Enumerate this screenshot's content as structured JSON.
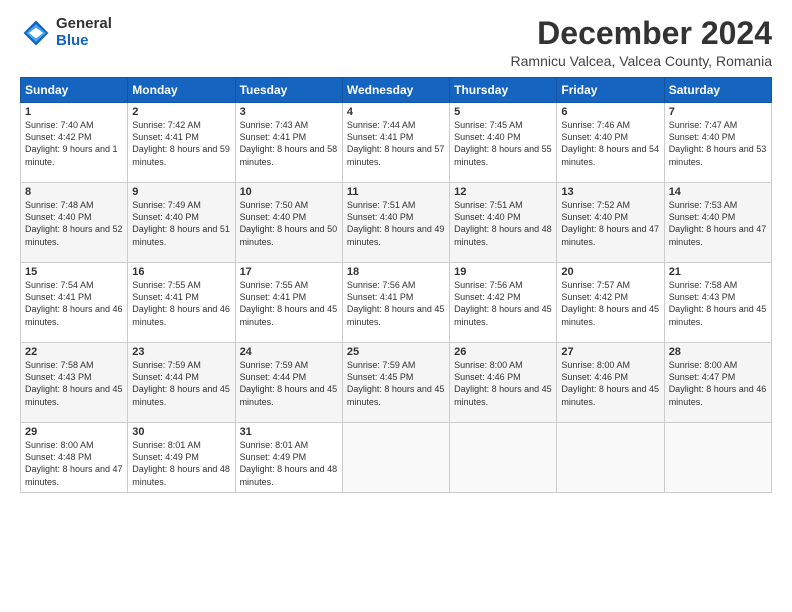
{
  "logo": {
    "general": "General",
    "blue": "Blue"
  },
  "title": "December 2024",
  "subtitle": "Ramnicu Valcea, Valcea County, Romania",
  "headers": [
    "Sunday",
    "Monday",
    "Tuesday",
    "Wednesday",
    "Thursday",
    "Friday",
    "Saturday"
  ],
  "weeks": [
    [
      {
        "day": "1",
        "sunrise": "Sunrise: 7:40 AM",
        "sunset": "Sunset: 4:42 PM",
        "daylight": "Daylight: 9 hours and 1 minute."
      },
      {
        "day": "2",
        "sunrise": "Sunrise: 7:42 AM",
        "sunset": "Sunset: 4:41 PM",
        "daylight": "Daylight: 8 hours and 59 minutes."
      },
      {
        "day": "3",
        "sunrise": "Sunrise: 7:43 AM",
        "sunset": "Sunset: 4:41 PM",
        "daylight": "Daylight: 8 hours and 58 minutes."
      },
      {
        "day": "4",
        "sunrise": "Sunrise: 7:44 AM",
        "sunset": "Sunset: 4:41 PM",
        "daylight": "Daylight: 8 hours and 57 minutes."
      },
      {
        "day": "5",
        "sunrise": "Sunrise: 7:45 AM",
        "sunset": "Sunset: 4:40 PM",
        "daylight": "Daylight: 8 hours and 55 minutes."
      },
      {
        "day": "6",
        "sunrise": "Sunrise: 7:46 AM",
        "sunset": "Sunset: 4:40 PM",
        "daylight": "Daylight: 8 hours and 54 minutes."
      },
      {
        "day": "7",
        "sunrise": "Sunrise: 7:47 AM",
        "sunset": "Sunset: 4:40 PM",
        "daylight": "Daylight: 8 hours and 53 minutes."
      }
    ],
    [
      {
        "day": "8",
        "sunrise": "Sunrise: 7:48 AM",
        "sunset": "Sunset: 4:40 PM",
        "daylight": "Daylight: 8 hours and 52 minutes."
      },
      {
        "day": "9",
        "sunrise": "Sunrise: 7:49 AM",
        "sunset": "Sunset: 4:40 PM",
        "daylight": "Daylight: 8 hours and 51 minutes."
      },
      {
        "day": "10",
        "sunrise": "Sunrise: 7:50 AM",
        "sunset": "Sunset: 4:40 PM",
        "daylight": "Daylight: 8 hours and 50 minutes."
      },
      {
        "day": "11",
        "sunrise": "Sunrise: 7:51 AM",
        "sunset": "Sunset: 4:40 PM",
        "daylight": "Daylight: 8 hours and 49 minutes."
      },
      {
        "day": "12",
        "sunrise": "Sunrise: 7:51 AM",
        "sunset": "Sunset: 4:40 PM",
        "daylight": "Daylight: 8 hours and 48 minutes."
      },
      {
        "day": "13",
        "sunrise": "Sunrise: 7:52 AM",
        "sunset": "Sunset: 4:40 PM",
        "daylight": "Daylight: 8 hours and 47 minutes."
      },
      {
        "day": "14",
        "sunrise": "Sunrise: 7:53 AM",
        "sunset": "Sunset: 4:40 PM",
        "daylight": "Daylight: 8 hours and 47 minutes."
      }
    ],
    [
      {
        "day": "15",
        "sunrise": "Sunrise: 7:54 AM",
        "sunset": "Sunset: 4:41 PM",
        "daylight": "Daylight: 8 hours and 46 minutes."
      },
      {
        "day": "16",
        "sunrise": "Sunrise: 7:55 AM",
        "sunset": "Sunset: 4:41 PM",
        "daylight": "Daylight: 8 hours and 46 minutes."
      },
      {
        "day": "17",
        "sunrise": "Sunrise: 7:55 AM",
        "sunset": "Sunset: 4:41 PM",
        "daylight": "Daylight: 8 hours and 45 minutes."
      },
      {
        "day": "18",
        "sunrise": "Sunrise: 7:56 AM",
        "sunset": "Sunset: 4:41 PM",
        "daylight": "Daylight: 8 hours and 45 minutes."
      },
      {
        "day": "19",
        "sunrise": "Sunrise: 7:56 AM",
        "sunset": "Sunset: 4:42 PM",
        "daylight": "Daylight: 8 hours and 45 minutes."
      },
      {
        "day": "20",
        "sunrise": "Sunrise: 7:57 AM",
        "sunset": "Sunset: 4:42 PM",
        "daylight": "Daylight: 8 hours and 45 minutes."
      },
      {
        "day": "21",
        "sunrise": "Sunrise: 7:58 AM",
        "sunset": "Sunset: 4:43 PM",
        "daylight": "Daylight: 8 hours and 45 minutes."
      }
    ],
    [
      {
        "day": "22",
        "sunrise": "Sunrise: 7:58 AM",
        "sunset": "Sunset: 4:43 PM",
        "daylight": "Daylight: 8 hours and 45 minutes."
      },
      {
        "day": "23",
        "sunrise": "Sunrise: 7:59 AM",
        "sunset": "Sunset: 4:44 PM",
        "daylight": "Daylight: 8 hours and 45 minutes."
      },
      {
        "day": "24",
        "sunrise": "Sunrise: 7:59 AM",
        "sunset": "Sunset: 4:44 PM",
        "daylight": "Daylight: 8 hours and 45 minutes."
      },
      {
        "day": "25",
        "sunrise": "Sunrise: 7:59 AM",
        "sunset": "Sunset: 4:45 PM",
        "daylight": "Daylight: 8 hours and 45 minutes."
      },
      {
        "day": "26",
        "sunrise": "Sunrise: 8:00 AM",
        "sunset": "Sunset: 4:46 PM",
        "daylight": "Daylight: 8 hours and 45 minutes."
      },
      {
        "day": "27",
        "sunrise": "Sunrise: 8:00 AM",
        "sunset": "Sunset: 4:46 PM",
        "daylight": "Daylight: 8 hours and 45 minutes."
      },
      {
        "day": "28",
        "sunrise": "Sunrise: 8:00 AM",
        "sunset": "Sunset: 4:47 PM",
        "daylight": "Daylight: 8 hours and 46 minutes."
      }
    ],
    [
      {
        "day": "29",
        "sunrise": "Sunrise: 8:00 AM",
        "sunset": "Sunset: 4:48 PM",
        "daylight": "Daylight: 8 hours and 47 minutes."
      },
      {
        "day": "30",
        "sunrise": "Sunrise: 8:01 AM",
        "sunset": "Sunset: 4:49 PM",
        "daylight": "Daylight: 8 hours and 48 minutes."
      },
      {
        "day": "31",
        "sunrise": "Sunrise: 8:01 AM",
        "sunset": "Sunset: 4:49 PM",
        "daylight": "Daylight: 8 hours and 48 minutes."
      },
      null,
      null,
      null,
      null
    ]
  ]
}
